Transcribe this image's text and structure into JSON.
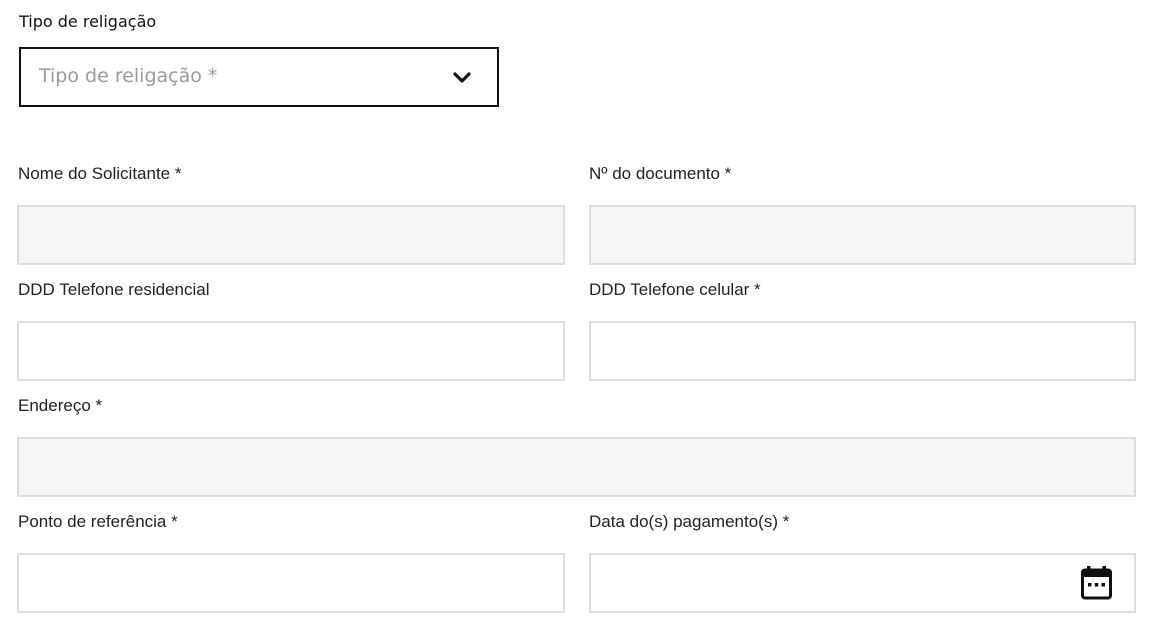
{
  "reconnection_type": {
    "label": "Tipo de religação",
    "placeholder": "Tipo de religação *",
    "icon": "chevron-down-icon"
  },
  "requester_name": {
    "label": "Nome do Solicitante *",
    "value": ""
  },
  "document_number": {
    "label": "Nº do documento *",
    "value": ""
  },
  "home_phone": {
    "label": "DDD Telefone residencial",
    "value": ""
  },
  "mobile_phone": {
    "label": "DDD Telefone celular *",
    "value": ""
  },
  "address": {
    "label": "Endereço *",
    "value": ""
  },
  "reference_point": {
    "label": "Ponto de referência *",
    "value": ""
  },
  "payment_date": {
    "label": "Data do(s) pagamento(s) *",
    "value": "",
    "icon": "calendar-icon"
  },
  "colors": {
    "text": "#222222",
    "placeholder": "#9a9a9a",
    "field_border": "#dedede",
    "readonly_field_bg": "#f6f6f6",
    "select_border": "#111111"
  }
}
